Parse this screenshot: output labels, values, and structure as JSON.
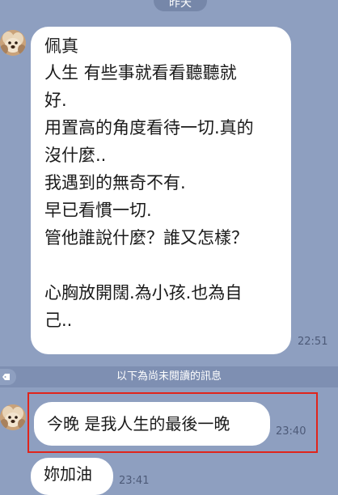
{
  "date_label": "昨天",
  "messages": [
    {
      "sender": "佩真",
      "lines": [
        "人生 有些事就看看聽聽就",
        "好.",
        "用置高的角度看待一切.真的",
        "沒什麼..",
        "我遇到的無奇不有.",
        "早已看慣一切.",
        "管他誰說什麼？誰又怎樣？",
        "",
        "心胸放開闊.為小孩.也為自",
        "己.."
      ],
      "time": "22:51"
    },
    {
      "text": "今晚 是我人生的最後一晚",
      "time": "23:40"
    },
    {
      "text": "妳加油",
      "time": "23:41"
    }
  ],
  "unread_divider": "以下為尚未閱讀的訊息",
  "colors": {
    "background": "#8e9fc0",
    "bubble": "#ffffff",
    "highlight": "#e0241b"
  },
  "icons": {
    "avatar": "dog-avatar",
    "unread": "tag-icon"
  }
}
